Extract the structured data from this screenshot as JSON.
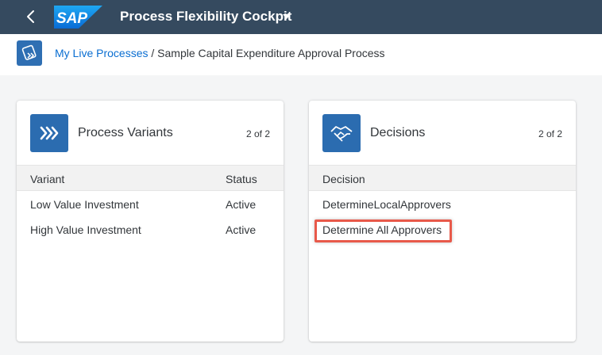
{
  "shell": {
    "app_title": "Process Flexibility Cockpit",
    "logo_text": "SAP",
    "brand_color": "#354a5f"
  },
  "header": {
    "breadcrumb_link": "My Live Processes",
    "breadcrumb_separator": " / ",
    "breadcrumb_current": "Sample Capital Expenditure Approval Process"
  },
  "variants_card": {
    "title": "Process Variants",
    "count": "2 of 2",
    "icon": "chevrons-right-icon",
    "columns": [
      "Variant",
      "Status"
    ],
    "rows": [
      {
        "variant": "Low Value Investment",
        "status": "Active"
      },
      {
        "variant": "High Value Investment",
        "status": "Active"
      }
    ]
  },
  "decisions_card": {
    "title": "Decisions",
    "count": "2 of 2",
    "icon": "handshake-icon",
    "columns": [
      "Decision"
    ],
    "rows": [
      {
        "decision": "DetermineLocalApprovers"
      },
      {
        "decision": "Determine All Approvers"
      }
    ],
    "highlight_color": "#e8594a"
  }
}
